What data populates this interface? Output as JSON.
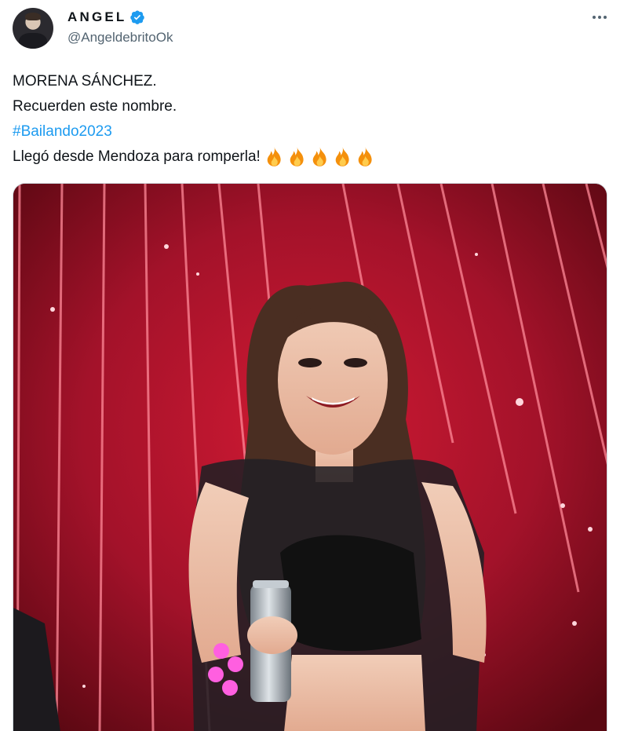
{
  "author": {
    "display_name": "ANGEL",
    "handle": "@AngeldebritoOk",
    "verified": true
  },
  "tweet": {
    "lines": [
      "MORENA SÁNCHEZ.",
      "Recuerden este nombre.",
      "#Bailando2023",
      "Llegó desde Mendoza para romperla!"
    ],
    "emoji": [
      "fire-icon",
      "fire-icon",
      "fire-icon",
      "fire-icon",
      "fire-icon"
    ]
  },
  "media": {
    "type": "photo"
  },
  "colors": {
    "link": "#1d9bf0",
    "verified": "#1d9bf0",
    "secondary_text": "#536471",
    "stage_red": "#b0162b"
  }
}
